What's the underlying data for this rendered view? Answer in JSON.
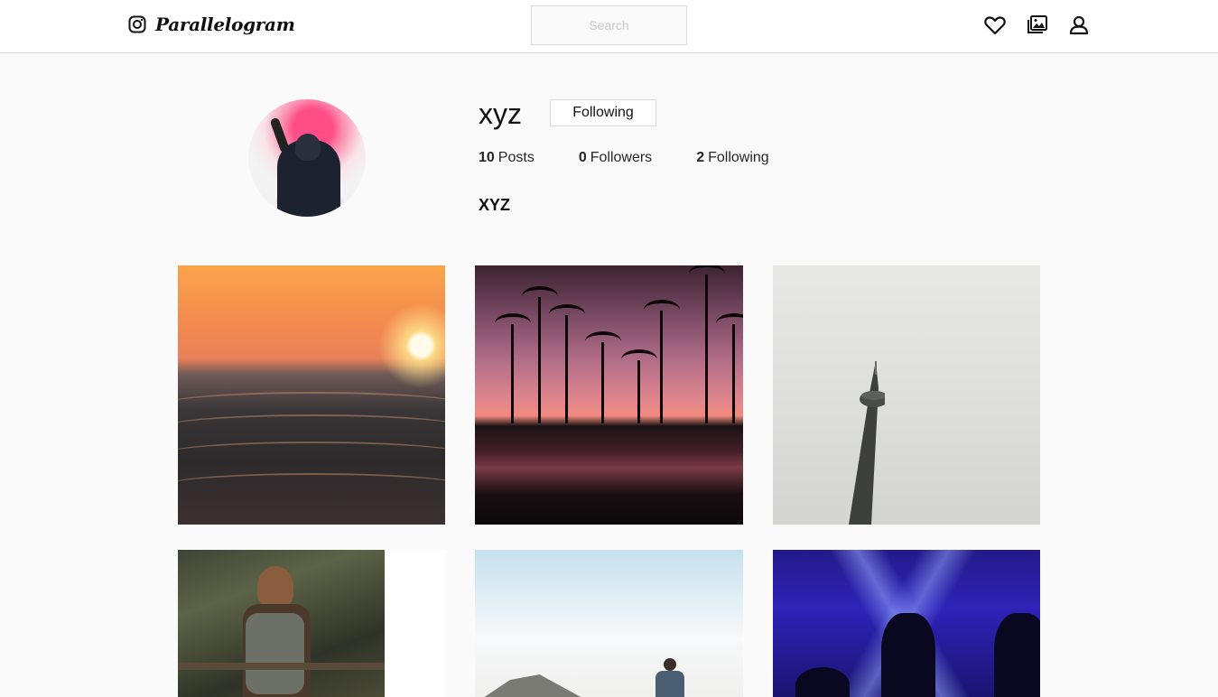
{
  "app": {
    "brand": "Parallelogram"
  },
  "search": {
    "placeholder": "Search"
  },
  "nav": {
    "icons": [
      "heart-icon",
      "gallery-icon",
      "user-icon"
    ]
  },
  "profile": {
    "username": "xyz",
    "follow_button": "Following",
    "stats": [
      {
        "count": "10",
        "label": "Posts"
      },
      {
        "count": "0",
        "label": "Followers"
      },
      {
        "count": "2",
        "label": "Following"
      }
    ],
    "full_name": "XYZ"
  },
  "posts": [
    "ocean-sunset-photo",
    "palm-trees-sunset-photo",
    "cn-tower-photo",
    "hiker-backpack-photo",
    "mountain-person-photo",
    "concert-lights-photo"
  ]
}
